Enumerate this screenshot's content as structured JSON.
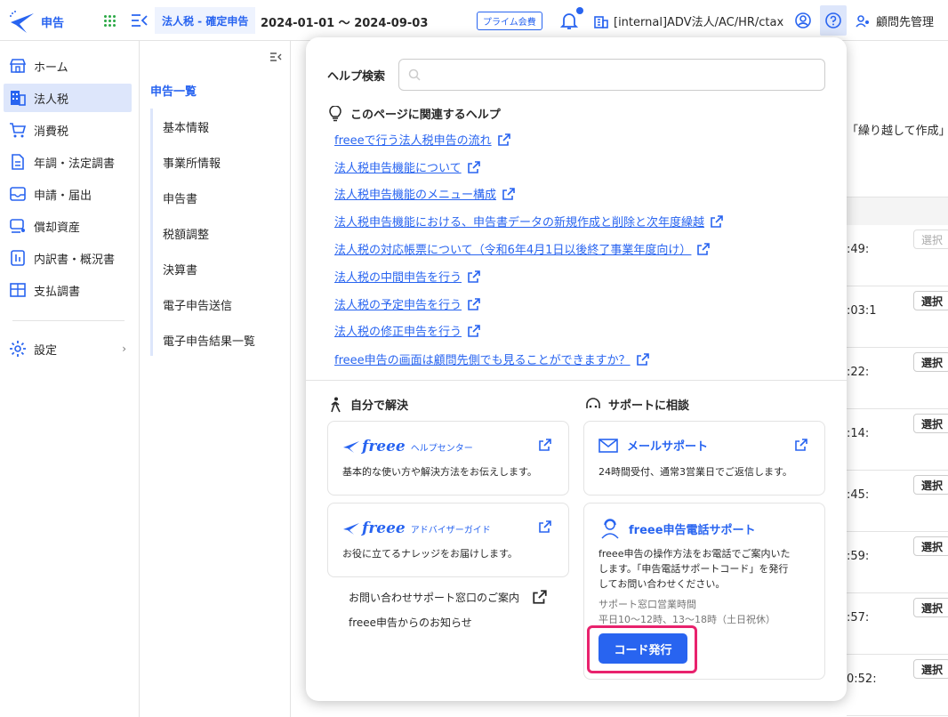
{
  "header": {
    "logo_text": "申告",
    "page_title": "法人税 - 確定申告",
    "period": "2024-01-01 〜 2024-09-03",
    "prime_badge": "プライム会費",
    "company": "[internal]ADV法人/AC/HR/ctax",
    "advisor": "顧問先管理",
    "accent_color": "#2864f0"
  },
  "sidebar": {
    "items": [
      {
        "label": "ホーム",
        "icon": "store-icon"
      },
      {
        "label": "法人税",
        "icon": "building-icon"
      },
      {
        "label": "消費税",
        "icon": "cart-icon"
      },
      {
        "label": "年調・法定調書",
        "icon": "document-icon"
      },
      {
        "label": "申請・届出",
        "icon": "inbox-icon"
      },
      {
        "label": "償却資産",
        "icon": "asset-icon"
      },
      {
        "label": "内訳書・概況書",
        "icon": "report-icon"
      },
      {
        "label": "支払調書",
        "icon": "table-icon"
      }
    ],
    "settings_label": "設定",
    "settings_chevron": "›"
  },
  "subnav": {
    "title": "申告一覧",
    "items": [
      "基本情報",
      "事業所情報",
      "申告書",
      "税額調整",
      "決算書",
      "電子申告送信",
      "電子申告結果一覧"
    ]
  },
  "background": {
    "partial_text": "「繰り越して作成」",
    "rows": [
      {
        "time": ":49:",
        "button": "選択"
      },
      {
        "time": ":03:1",
        "button": "選択"
      },
      {
        "time": ":22:",
        "button": "選択"
      },
      {
        "time": ":14:",
        "button": "選択"
      },
      {
        "time": ":45:",
        "button": "選択"
      },
      {
        "time": ":59:",
        "button": "選択"
      },
      {
        "time": ":57:",
        "button": "選択"
      },
      {
        "time": "0:52:",
        "button": "選択"
      }
    ]
  },
  "help": {
    "search_label": "ヘルプ検索",
    "search_value": "",
    "related_heading": "このページに関連するヘルプ",
    "links": [
      "freeeで行う法人税申告の流れ",
      "法人税申告機能について",
      "法人税申告機能のメニュー構成",
      "法人税申告機能における、申告書データの新規作成と削除と次年度繰越",
      "法人税の対応帳票について（令和6年4月1日以後終了事業年度向け）",
      "法人税の中間申告を行う",
      "法人税の予定申告を行う",
      "法人税の修正申告を行う",
      "freee申告の画面は顧問先側でも見ることができますか？"
    ],
    "self_heading": "自分で解決",
    "support_heading": "サポートに相談",
    "help_center": {
      "brand": "freee",
      "name": "ヘルプセンター",
      "desc": "基本的な使い方や解決方法をお伝えします。"
    },
    "advisor_guide": {
      "brand": "freee",
      "name": "アドバイザーガイド",
      "desc": "お役に立てるナレッジをお届けします。"
    },
    "contact_link": "お問い合わせサポート窓口のご案内",
    "news_link": "freee申告からのお知らせ",
    "mail_support": {
      "title": "メールサポート",
      "desc": "24時間受付、通常3営業日でご返信します。"
    },
    "phone_support": {
      "title": "freee申告電話サポート",
      "desc_lines": [
        "freee申告の操作方法をお電話でご案内いた",
        "します。「申告電話サポートコード」を発行",
        "してお問い合わせください。"
      ],
      "hours_label": "サポート窓口営業時間",
      "hours_value": "平日10〜12時、13〜18時（土日祝休）",
      "button": "コード発行"
    },
    "highlight_color": "#e8226d"
  }
}
